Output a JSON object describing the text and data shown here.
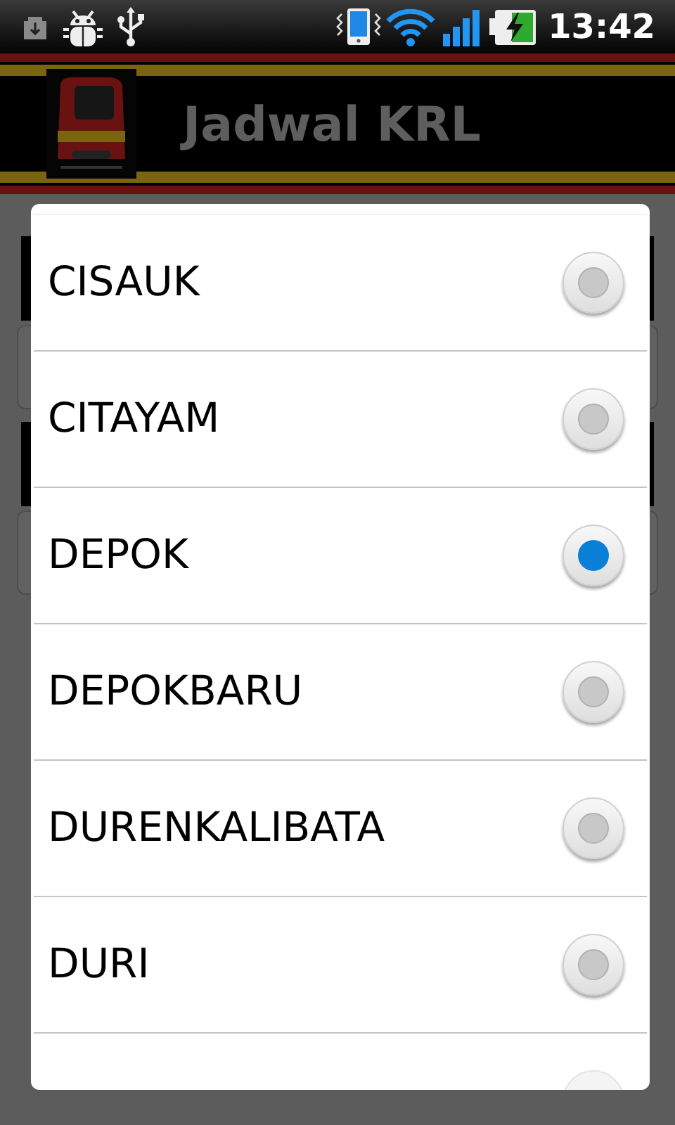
{
  "status_bar": {
    "time": "13:42"
  },
  "header": {
    "title": "Jadwal KRL"
  },
  "dialog": {
    "options": [
      {
        "label": "CISAUK",
        "selected": false
      },
      {
        "label": "CITAYAM",
        "selected": false
      },
      {
        "label": "DEPOK",
        "selected": true
      },
      {
        "label": "DEPOKBARU",
        "selected": false
      },
      {
        "label": "DURENKALIBATA",
        "selected": false
      },
      {
        "label": "DURI",
        "selected": false
      }
    ]
  }
}
